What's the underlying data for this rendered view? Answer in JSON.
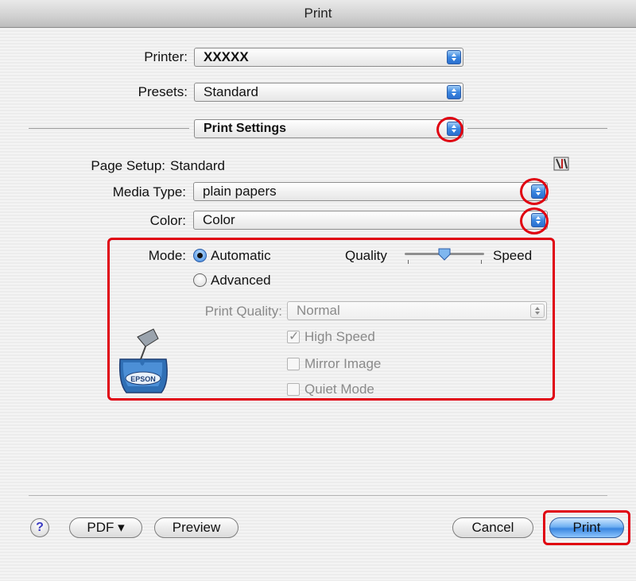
{
  "window": {
    "title": "Print"
  },
  "printer": {
    "label": "Printer:",
    "value": "XXXXX"
  },
  "presets": {
    "label": "Presets:",
    "value": "Standard"
  },
  "panel": {
    "value": "Print Settings"
  },
  "page_setup": {
    "label": "Page Setup:",
    "value": "Standard"
  },
  "media_type": {
    "label": "Media Type:",
    "value": "plain papers"
  },
  "color": {
    "label": "Color:",
    "value": "Color"
  },
  "mode": {
    "label": "Mode:",
    "automatic": "Automatic",
    "advanced": "Advanced",
    "selected": "Automatic",
    "quality_label": "Quality",
    "speed_label": "Speed",
    "quality_speed_level": 0.5
  },
  "print_quality": {
    "label": "Print Quality:",
    "value": "Normal"
  },
  "options": {
    "high_speed": {
      "label": "High Speed",
      "checked": true
    },
    "mirror_image": {
      "label": "Mirror Image",
      "checked": false
    },
    "quiet_mode": {
      "label": "Quiet Mode",
      "checked": false
    }
  },
  "logo": {
    "text": "EPSON"
  },
  "buttons": {
    "help": "?",
    "pdf": "PDF ▾",
    "preview": "Preview",
    "cancel": "Cancel",
    "print": "Print"
  },
  "colors": {
    "highlight": "#e00010",
    "accent": "#3a86e0"
  }
}
